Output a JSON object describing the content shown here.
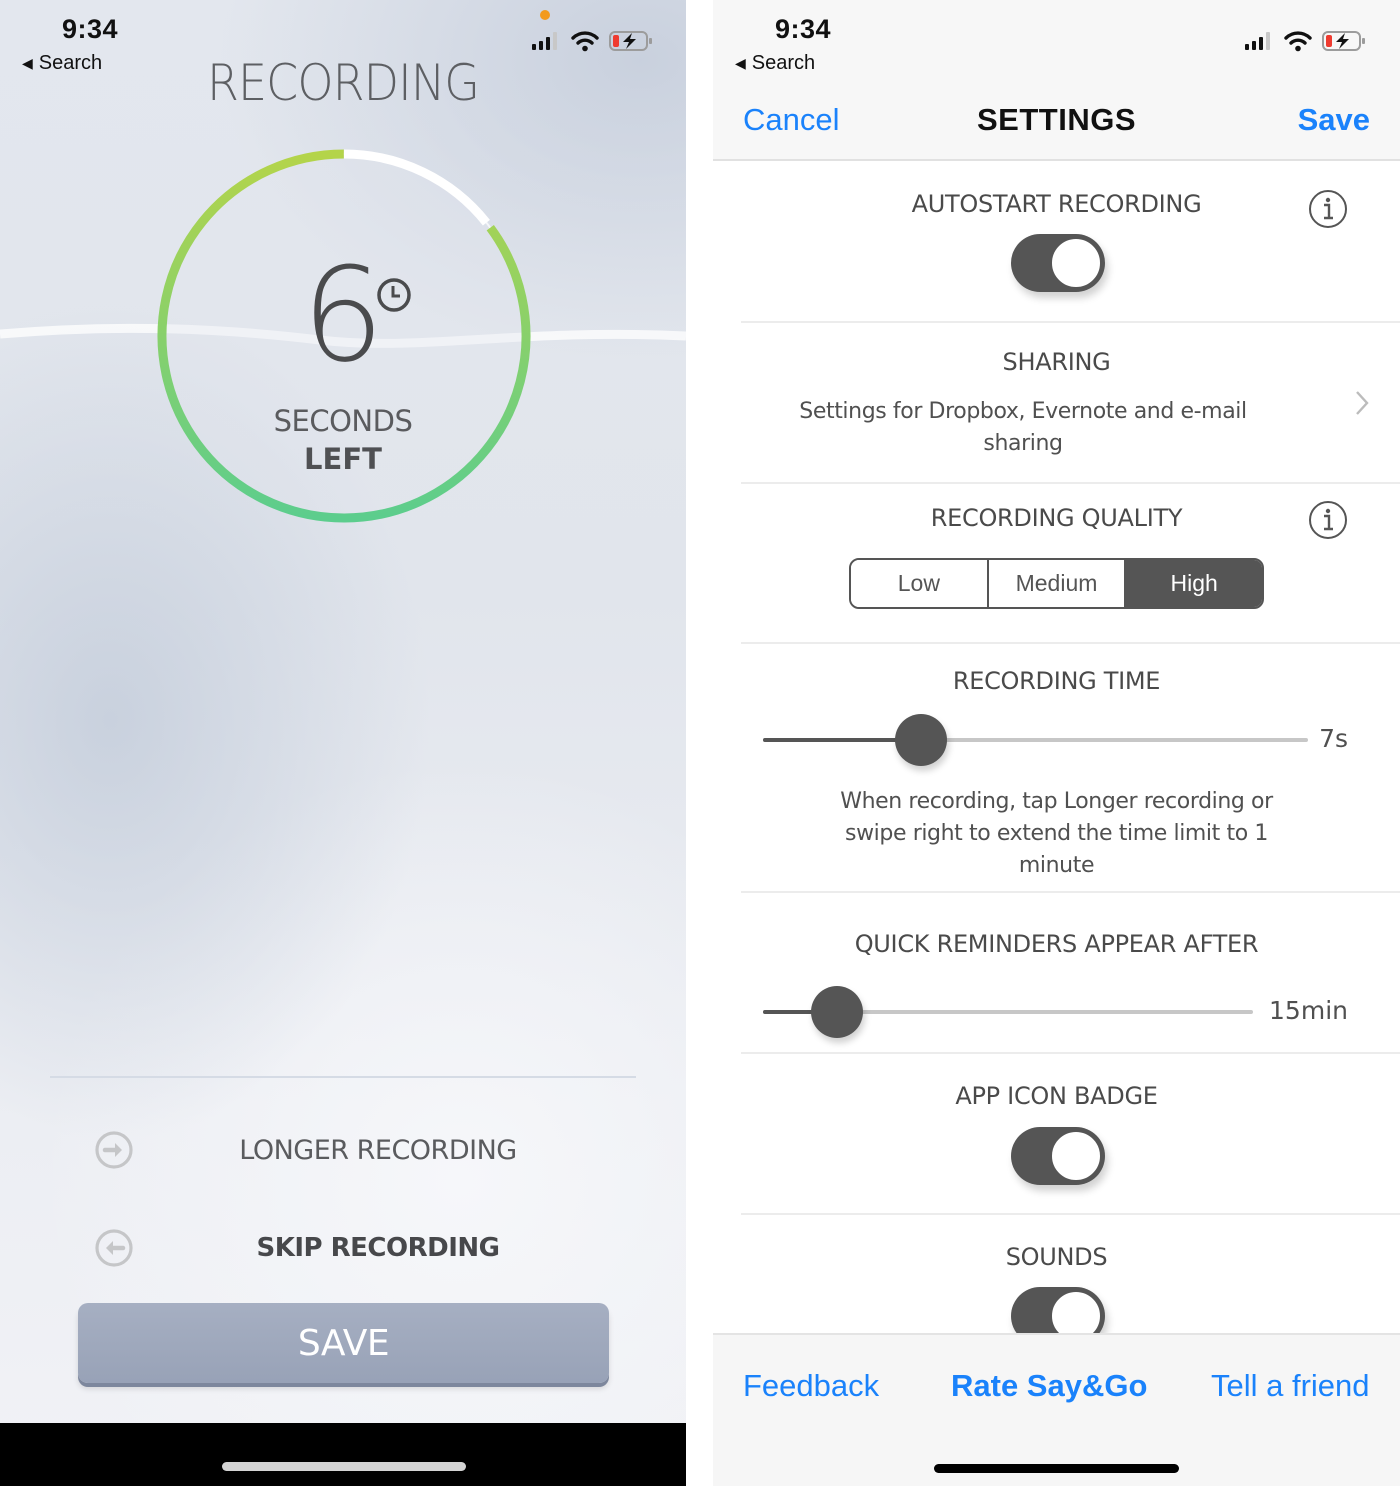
{
  "left": {
    "status": {
      "time": "9:34",
      "back_label": "Search",
      "icons": [
        "cellular-signal-icon",
        "wifi-icon",
        "battery-charging-icon"
      ],
      "privacy_dot_color": "#f39a1e"
    },
    "title": "RECORDING",
    "timer": {
      "seconds_left": "6",
      "total_seconds": 7,
      "remaining_fraction": 0.857,
      "label_line1": "SECONDS",
      "label_line2": "LEFT",
      "ring_colors": {
        "start": "#bcd64a",
        "end": "#5fcd8a",
        "elapsed": "#ffffff"
      }
    },
    "actions": [
      {
        "label": "LONGER RECORDING",
        "icon": "arrow-right-circle-icon"
      },
      {
        "label": "SKIP RECORDING",
        "icon": "arrow-left-circle-icon"
      }
    ],
    "save_label": "SAVE"
  },
  "right": {
    "status": {
      "time": "9:34",
      "back_label": "Search",
      "icons": [
        "cellular-signal-icon",
        "wifi-icon",
        "battery-charging-icon"
      ]
    },
    "nav": {
      "cancel": "Cancel",
      "title": "SETTINGS",
      "save": "Save"
    },
    "settings": {
      "autostart": {
        "title": "AUTOSTART RECORDING",
        "enabled": true
      },
      "sharing": {
        "title": "SHARING",
        "description": "Settings for Dropbox, Evernote and e-mail sharing"
      },
      "quality": {
        "title": "RECORDING QUALITY",
        "options": [
          "Low",
          "Medium",
          "High"
        ],
        "selected": "High"
      },
      "recording_time": {
        "title": "RECORDING TIME",
        "value": "7s",
        "fraction": 0.29,
        "description": "When recording, tap Longer recording or swipe right to extend the time limit to 1 minute"
      },
      "quick_reminders": {
        "title": "QUICK REMINDERS APPEAR AFTER",
        "value": "15min",
        "fraction": 0.15
      },
      "app_icon_badge": {
        "title": "APP ICON BADGE",
        "enabled": true
      },
      "sounds": {
        "title": "SOUNDS",
        "enabled": true
      }
    },
    "footer": {
      "feedback": "Feedback",
      "rate": "Rate Say&Go",
      "tell": "Tell a friend"
    },
    "accent_color": "#1a82fb"
  }
}
